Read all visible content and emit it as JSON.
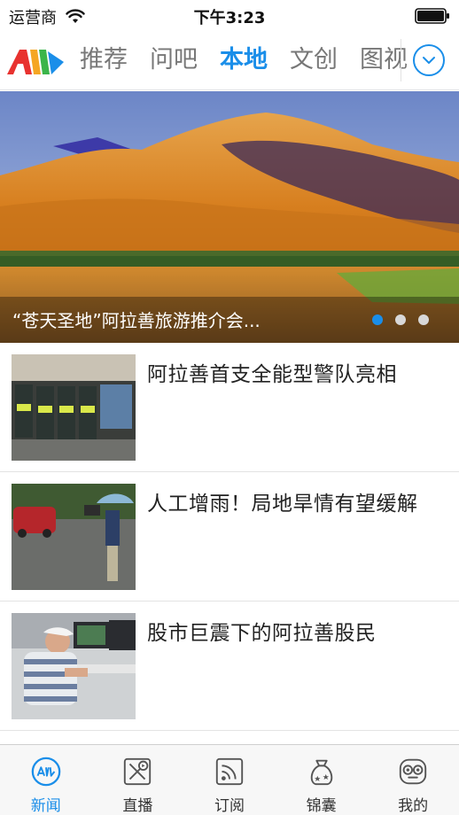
{
  "status_bar": {
    "carrier": "运营商",
    "time": "下午3:23"
  },
  "nav": {
    "tabs": [
      {
        "label": "推荐",
        "active": false
      },
      {
        "label": "问吧",
        "active": false
      },
      {
        "label": "本地",
        "active": true
      },
      {
        "label": "文创",
        "active": false
      },
      {
        "label": "图视",
        "active": false
      }
    ],
    "accent_color": "#1a8ee9"
  },
  "banner": {
    "caption": "“苍天圣地”阿拉善旅游推介会...",
    "page_count": 3,
    "active_page": 1
  },
  "news": [
    {
      "title": "阿拉善首支全能型警队亮相",
      "thumb_icon": "police-team-photo"
    },
    {
      "title": "人工增雨！局地旱情有望缓解",
      "thumb_icon": "rainy-street-photo"
    },
    {
      "title": "股市巨震下的阿拉善股民",
      "thumb_icon": "stock-trader-photo"
    }
  ],
  "tabbar": {
    "items": [
      {
        "label": "新闻",
        "icon": "news-icon",
        "active": true
      },
      {
        "label": "直播",
        "icon": "live-icon",
        "active": false
      },
      {
        "label": "订阅",
        "icon": "rss-icon",
        "active": false
      },
      {
        "label": "锦囊",
        "icon": "pouch-icon",
        "active": false
      },
      {
        "label": "我的",
        "icon": "profile-icon",
        "active": false
      }
    ]
  }
}
